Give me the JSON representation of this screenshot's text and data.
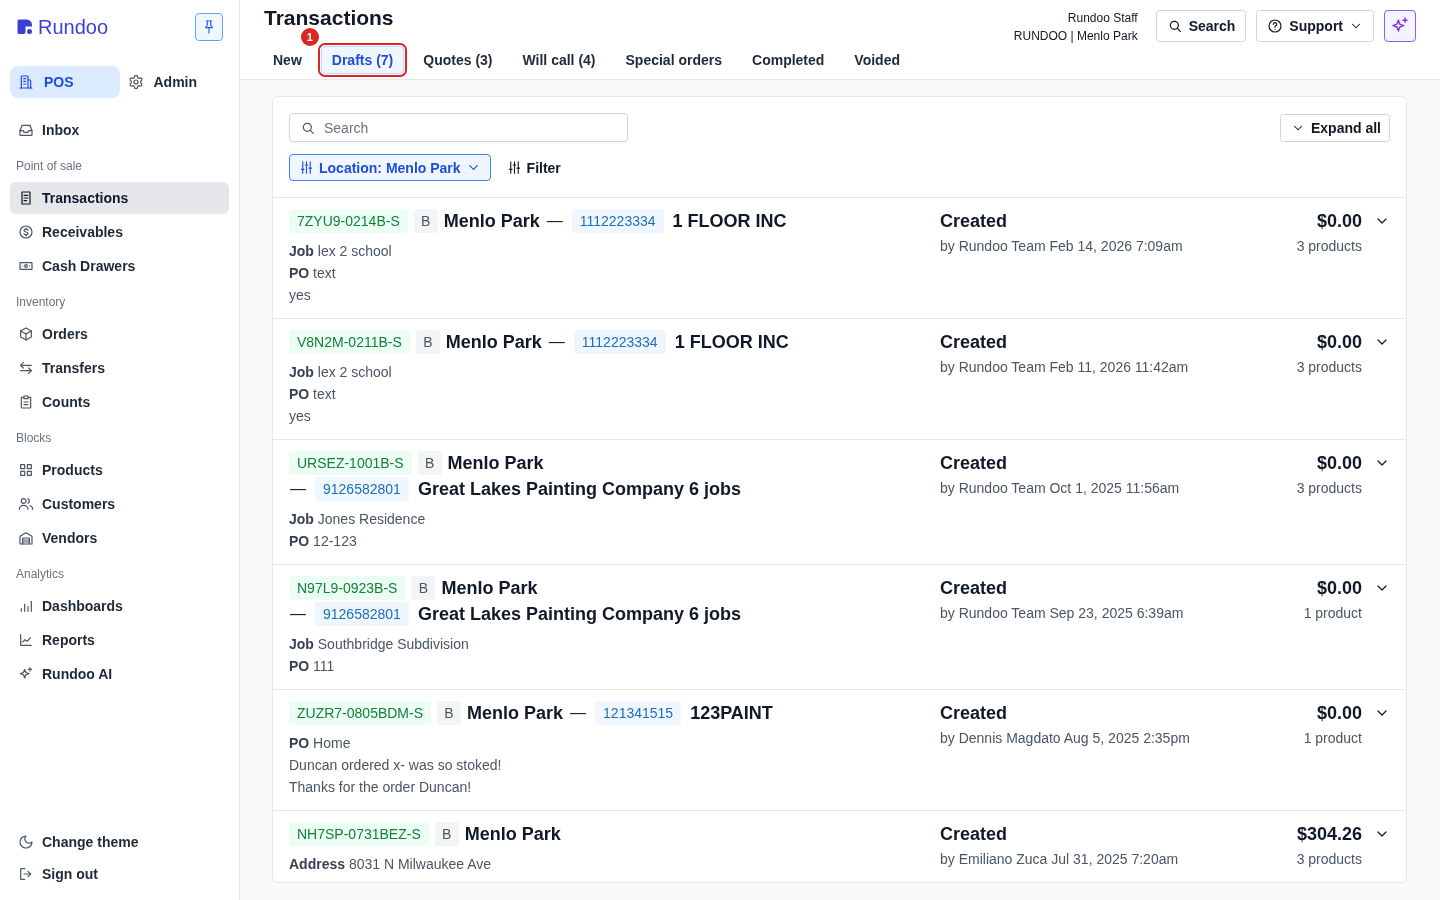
{
  "sidebar": {
    "brand": "Rundoo",
    "pinned": true,
    "modes": [
      {
        "label": "POS",
        "selected": true
      },
      {
        "label": "Admin",
        "selected": false
      }
    ],
    "sections": [
      {
        "items": [
          {
            "label": "Inbox",
            "selected": false
          }
        ]
      },
      {
        "heading": "Point of sale",
        "items": [
          {
            "label": "Transactions",
            "selected": true
          },
          {
            "label": "Receivables",
            "selected": false
          },
          {
            "label": "Cash Drawers",
            "selected": false
          }
        ]
      },
      {
        "heading": "Inventory",
        "items": [
          {
            "label": "Orders",
            "selected": false
          },
          {
            "label": "Transfers",
            "selected": false
          },
          {
            "label": "Counts",
            "selected": false
          }
        ]
      },
      {
        "heading": "Blocks",
        "items": [
          {
            "label": "Products",
            "selected": false
          },
          {
            "label": "Customers",
            "selected": false
          },
          {
            "label": "Vendors",
            "selected": false
          }
        ]
      },
      {
        "heading": "Analytics",
        "items": [
          {
            "label": "Dashboards",
            "selected": false
          },
          {
            "label": "Reports",
            "selected": false
          },
          {
            "label": "Rundoo AI",
            "selected": false
          }
        ]
      }
    ],
    "footer_items": [
      {
        "label": "Change theme"
      },
      {
        "label": "Sign out"
      }
    ]
  },
  "header": {
    "title": "Transactions",
    "step_marker": "1",
    "tabs": [
      {
        "label": "New",
        "selected": false,
        "highlighted": false
      },
      {
        "label": "Drafts (7)",
        "selected": true,
        "highlighted": true
      },
      {
        "label": "Quotes (3)",
        "selected": false,
        "highlighted": false
      },
      {
        "label": "Will call (4)",
        "selected": false,
        "highlighted": false
      },
      {
        "label": "Special orders",
        "selected": false,
        "highlighted": false
      },
      {
        "label": "Completed",
        "selected": false,
        "highlighted": false
      },
      {
        "label": "Voided",
        "selected": false,
        "highlighted": false
      }
    ],
    "user": {
      "name": "Rundoo Staff",
      "store": "RUNDOO | Menlo Park"
    },
    "search_button": "Search",
    "support_button": "Support"
  },
  "list": {
    "search": {
      "placeholder": "Search"
    },
    "expand_all": "Expand all",
    "location_filter": {
      "label": "Location: Menlo Park",
      "active": true
    },
    "filter_button": "Filter",
    "rows": [
      {
        "code": "7ZYU9-0214B-S",
        "type": "B",
        "location": "Menlo Park",
        "separator": "—",
        "phone": "1112223334",
        "customer": "1 FLOOR INC",
        "details": [
          "**Job** lex 2 school",
          "**PO** text",
          "yes"
        ],
        "status": "Created",
        "created": "by Rundoo Team Feb 14, 2026 7:09am",
        "total": "$0.00",
        "count": "3 products",
        "expanded": false
      },
      {
        "code": "V8N2M-0211B-S",
        "type": "B",
        "location": "Menlo Park",
        "separator": "—",
        "phone": "1112223334",
        "customer": "1 FLOOR INC",
        "details": [
          "**Job** lex 2 school",
          "**PO** text",
          "yes"
        ],
        "status": "Created",
        "created": "by Rundoo Team Feb 11, 2026 11:42am",
        "total": "$0.00",
        "count": "3 products",
        "expanded": false
      },
      {
        "code": "URSEZ-1001B-S",
        "type": "B",
        "location": "Menlo Park",
        "separator": "—",
        "phone": "9126582801",
        "customer": "Great Lakes Painting Company 6 jobs",
        "details": [
          "**Job** Jones Residence",
          "**PO** 12-123"
        ],
        "status": "Created",
        "created": "by Rundoo Team Oct 1, 2025 11:56am",
        "total": "$0.00",
        "count": "3 products",
        "expanded": false
      },
      {
        "code": "N97L9-0923B-S",
        "type": "B",
        "location": "Menlo Park",
        "separator": "—",
        "phone": "9126582801",
        "customer": "Great Lakes Painting Company 6 jobs",
        "details": [
          "**Job** Southbridge Subdivision",
          "**PO** 111"
        ],
        "status": "Created",
        "created": "by Rundoo Team Sep 23, 2025 6:39am",
        "total": "$0.00",
        "count": "1 product",
        "expanded": false
      },
      {
        "code": "ZUZR7-0805BDM-S",
        "type": "B",
        "location": "Menlo Park",
        "separator": "—",
        "phone": "121341515",
        "customer": "123PAINT",
        "details": [
          "**PO** Home",
          "Duncan ordered x- was so stoked!",
          "Thanks for the order Duncan!"
        ],
        "status": "Created",
        "created": "by Dennis Magdato Aug 5, 2025 2:35pm",
        "total": "$0.00",
        "count": "1 product",
        "expanded": false
      },
      {
        "code": "NH7SP-0731BEZ-S",
        "type": "B",
        "location": "Menlo Park",
        "details": [
          "**Address** 8031 N Milwaukee Ave"
        ],
        "status": "Created",
        "created": "by Emiliano Zuca Jul 31, 2025 7:20am",
        "total": "$304.26",
        "count": "3 products",
        "expanded": false
      }
    ]
  }
}
